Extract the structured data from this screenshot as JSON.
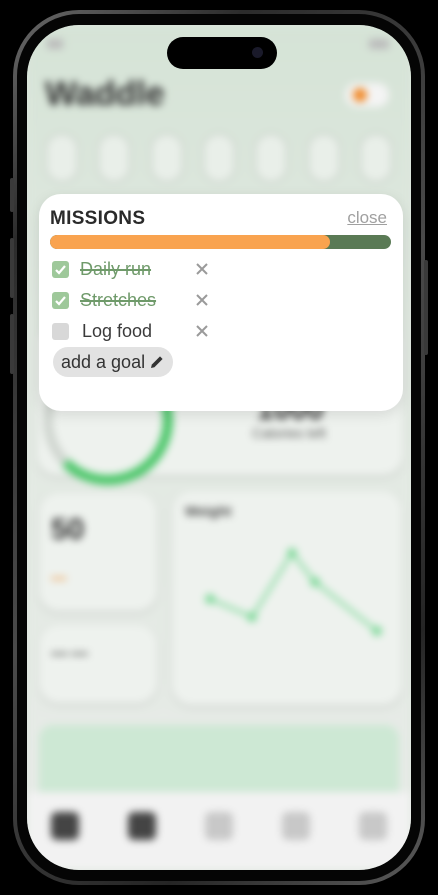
{
  "missions": {
    "title": "MISSIONS",
    "close_label": "close",
    "progress_percent": 82,
    "add_goal_label": "add a goal",
    "goals": [
      {
        "label": "Daily run",
        "done": true
      },
      {
        "label": "Stretches",
        "done": true
      },
      {
        "label": "Log food",
        "done": false
      }
    ]
  },
  "background": {
    "app_title": "Waddle",
    "fifty": "50",
    "calories_label": "Calories left",
    "weight_label": "Weight"
  },
  "colors": {
    "progress_fill": "#f9a34f",
    "progress_track": "#5a7a55",
    "checked": "#9ec89a",
    "done_text": "#6f9a6a"
  },
  "icons": {
    "checkbox": "checkmark-icon",
    "delete": "close-x-icon",
    "edit": "pencil-icon"
  }
}
